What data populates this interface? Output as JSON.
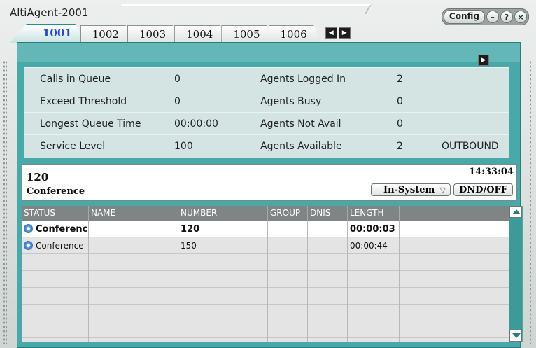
{
  "app": {
    "title": "AltiAgent-2001"
  },
  "window_controls": {
    "config_label": "Config",
    "minimize_label": "–",
    "help_label": "?",
    "close_label": "×"
  },
  "tabs": [
    {
      "label": "1001",
      "active": true
    },
    {
      "label": "1002"
    },
    {
      "label": "1003"
    },
    {
      "label": "1004"
    },
    {
      "label": "1005"
    },
    {
      "label": "1006"
    }
  ],
  "tab_nav": {
    "prev_icon": "arrow-left-icon",
    "next_icon": "arrow-right-icon",
    "prev": "◀",
    "next": "▶"
  },
  "panel": {
    "expand_icon": "▶"
  },
  "stats": {
    "rows": [
      {
        "label": "Calls in Queue",
        "value": "0",
        "label2": "Agents Logged In",
        "value2": "2",
        "extra": ""
      },
      {
        "label": "Exceed Threshold",
        "value": "0",
        "label2": "Agents Busy",
        "value2": "0",
        "extra": ""
      },
      {
        "label": "Longest Queue Time",
        "value": "00:00:00",
        "label2": "Agents Not Avail",
        "value2": "0",
        "extra": ""
      },
      {
        "label": "Service Level",
        "value": "100",
        "label2": "Agents Available",
        "value2": "2",
        "extra": "OUTBOUND"
      }
    ]
  },
  "call": {
    "number": "120",
    "state": "Conference",
    "time": "14:33:04",
    "status_select": "In-System",
    "dnd_label": "DND/OFF"
  },
  "table": {
    "headers": [
      "STATUS",
      "NAME",
      "NUMBER",
      "GROUP",
      "DNIS",
      "LENGTH"
    ],
    "rows": [
      {
        "status": "Conferenc",
        "name": "",
        "number": "120",
        "group": "",
        "dnis": "",
        "length": "00:00:03",
        "selected": true
      },
      {
        "status": "Conference",
        "name": "",
        "number": "150",
        "group": "",
        "dnis": "",
        "length": "00:00:44"
      }
    ]
  },
  "colors": {
    "teal": "#48a9a8",
    "active_tab_text": "#2b46c8",
    "header_bg": "#7f8584"
  }
}
